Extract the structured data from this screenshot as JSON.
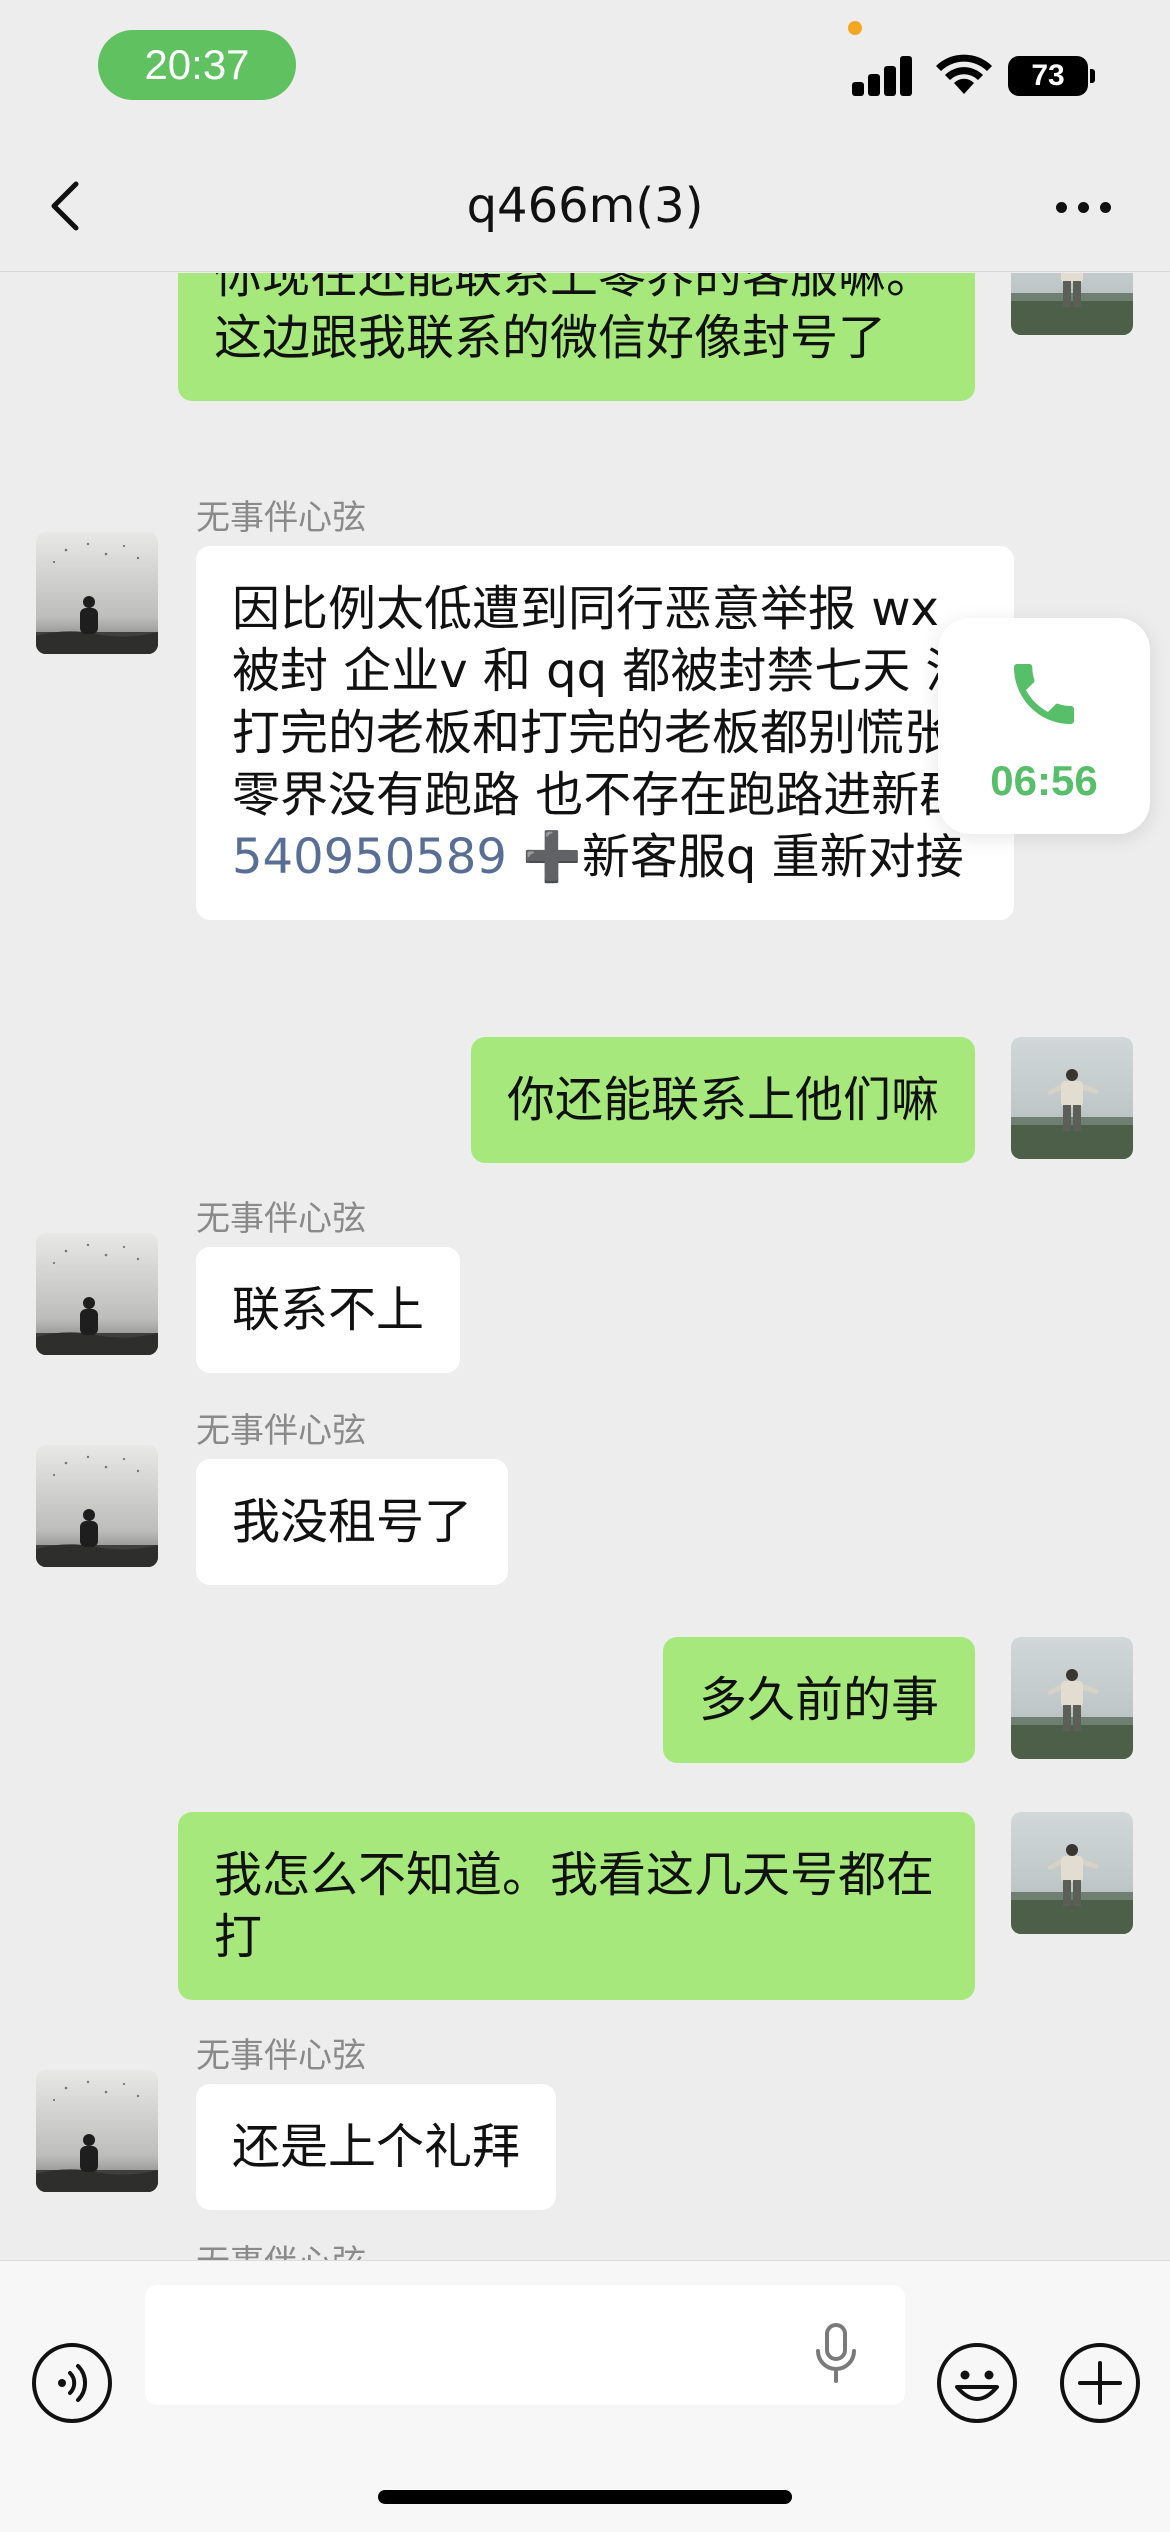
{
  "status_bar": {
    "time": "20:37",
    "battery": "73"
  },
  "nav": {
    "title": "q466m(3)"
  },
  "messages": [
    {
      "side": "right",
      "text": "你现在还能联系上零界的客服嘛。这边跟我联系的微信好像封号了"
    },
    {
      "side": "left",
      "sender": "无事伴心弦",
      "text_before_link": "因比例太低遭到同行恶意举报 wx被封  企业v 和 qq 都被封禁七天 没打完的老板和打完的老板都别慌张 零界没有跑路 也不存在跑路进新群",
      "link": "540950589",
      "text_after_link": " ➕新客服q 重新对接"
    },
    {
      "side": "right",
      "text": "你还能联系上他们嘛"
    },
    {
      "side": "left",
      "sender": "无事伴心弦",
      "text": "联系不上"
    },
    {
      "side": "left",
      "sender": "无事伴心弦",
      "text": "我没租号了"
    },
    {
      "side": "right",
      "text": "多久前的事"
    },
    {
      "side": "right",
      "text": "我怎么不知道。我看这几天号都在打"
    },
    {
      "side": "left",
      "sender": "无事伴心弦",
      "text": "还是上个礼拜"
    },
    {
      "side": "left",
      "sender": "无事伴心弦"
    }
  ],
  "call_widget": {
    "duration": "06:56"
  },
  "input": {
    "value": "",
    "placeholder": ""
  },
  "icons": {
    "back": "chevron-left-icon",
    "more": "more-icon",
    "phone": "phone-icon",
    "voice": "voice-icon",
    "mic": "mic-icon",
    "emoji": "emoji-icon",
    "plus": "plus-icon"
  },
  "colors": {
    "background": "#ededed",
    "own_bubble": "#a6e87c",
    "other_bubble": "#ffffff",
    "time_pill": "#5fc15f",
    "call_green": "#57be6a",
    "link": "#586e95"
  }
}
